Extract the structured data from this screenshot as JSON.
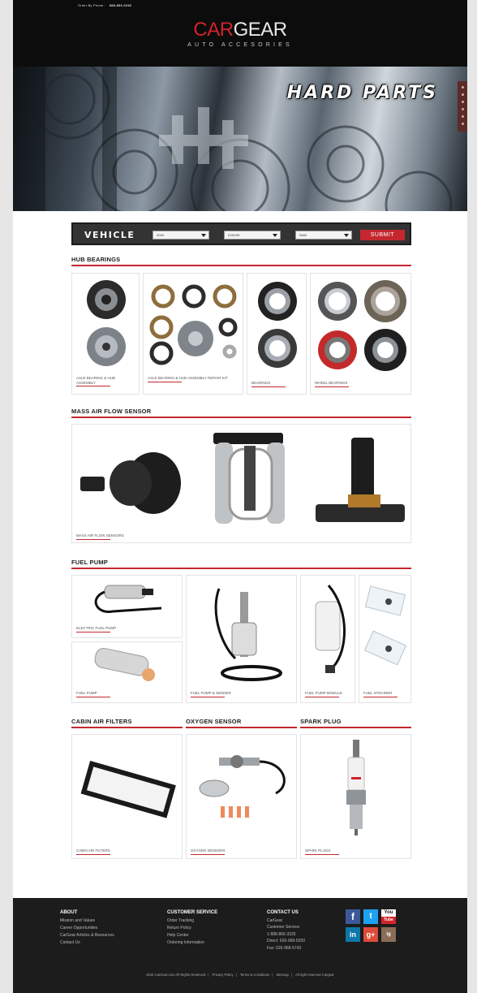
{
  "header": {
    "order_label": "Order By Phone:",
    "order_phone": "888-866-3246",
    "logo_car": "CAR",
    "logo_gear": "GEAR",
    "logo_sub": "AUTO ACCESORIES"
  },
  "hero": {
    "title": "HARD PARTS"
  },
  "vehicle": {
    "label": "VEHICLE",
    "year": "2000",
    "make": "DODGE",
    "model": "RAM",
    "submit": "SUBMIT"
  },
  "sections": {
    "hub": {
      "title": "HUB BEARINGS",
      "items": [
        "AXLE BEARING & HUB ASSEMBLY",
        "AXLE BEARING & HUB ASSEMBLY REPAIR KIT",
        "BEARINGS",
        "WHEEL BEARINGS"
      ]
    },
    "maf": {
      "title": "MASS AIR FLOW SENSOR",
      "items": [
        "MASS AIR FLOW SENSORS"
      ]
    },
    "fuel": {
      "title": "FUEL PUMP",
      "items": [
        "ELECTRIC FUEL PUMP",
        "FUEL PUMP",
        "FUEL PUMP & SENDER",
        "FUEL PUMP MODULE",
        "FUEL STRAINER"
      ]
    },
    "cabin": {
      "title": "CABIN AIR FILTERS",
      "items": [
        "CABIN AIR FILTERS"
      ]
    },
    "oxygen": {
      "title": "OXYGEN SENSOR",
      "items": [
        "OXYGEN SENSORS"
      ]
    },
    "spark": {
      "title": "SPARK PLUG",
      "items": [
        "SPARK PLUGS"
      ]
    }
  },
  "footer": {
    "about": {
      "title": "ABOUT",
      "links": [
        "Mission and Values",
        "Career Opportunities",
        "CarGear Articles & Resources",
        "Contact Us"
      ]
    },
    "service": {
      "title": "CUSTOMER SERVICE",
      "links": [
        "Order Tracking",
        "Return Policy",
        "Help Center",
        "Ordering Information"
      ]
    },
    "contact": {
      "title": "CONTACT US",
      "lines": [
        "CarGear",
        "Customer Service:",
        "1-888-866-3226",
        "Direct: 626-968-5200",
        "Fax: 626-968-5742"
      ]
    },
    "social": [
      "f",
      "t",
      "You",
      "in",
      "g+",
      "ig"
    ],
    "bottom": [
      "2015 CarGear.com All Rights Reserved",
      "Privacy Policy",
      "Terms & Conditions",
      "Sitemap",
      "All right reserved Cargear"
    ]
  },
  "colors": {
    "accent": "#c4272e",
    "header_bg": "#0c0c0c",
    "footer_bg": "#1c1c1c"
  },
  "icons": {
    "facebook": "facebook-icon",
    "twitter": "twitter-icon",
    "youtube": "youtube-icon",
    "linkedin": "linkedin-icon",
    "googleplus": "googleplus-icon",
    "instagram": "instagram-icon"
  }
}
